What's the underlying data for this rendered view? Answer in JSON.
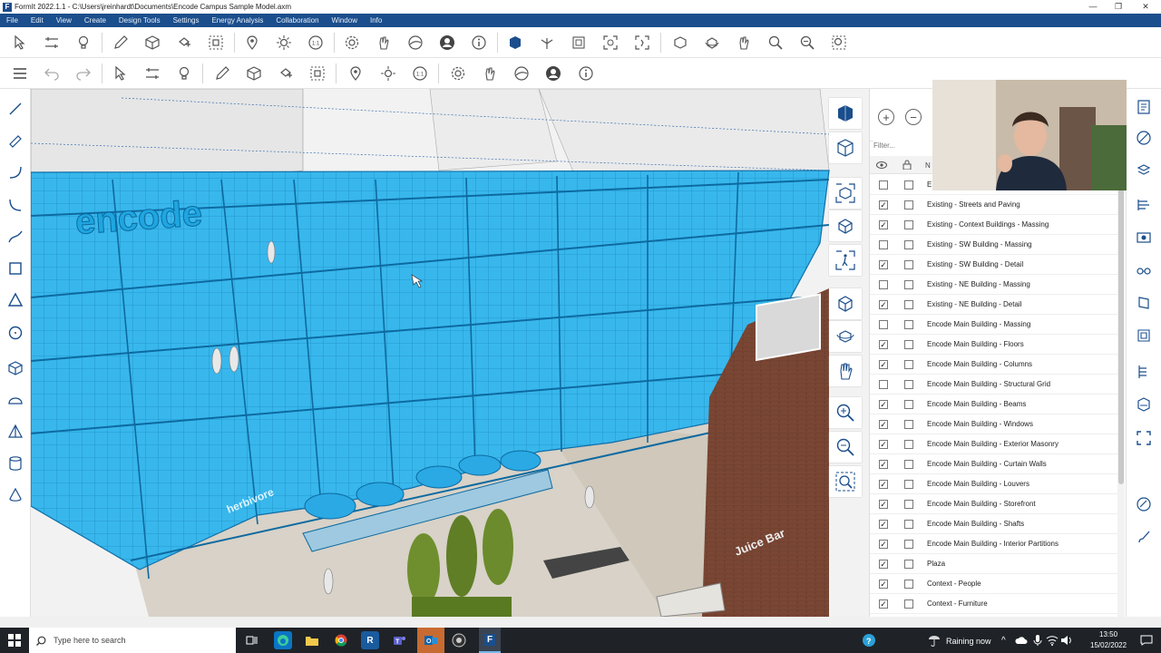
{
  "window": {
    "title": "FormIt 2022.1.1 - C:\\Users\\jreinhardt\\Documents\\Encode Campus Sample Model.axm",
    "logo": "F",
    "minimize": "—",
    "restore": "❐",
    "close": "✕"
  },
  "menu": [
    "File",
    "Edit",
    "View",
    "Create",
    "Design Tools",
    "Settings",
    "Energy Analysis",
    "Collaboration",
    "Window",
    "Info"
  ],
  "panel": {
    "add": "+",
    "remove": "−",
    "filter_placeholder": "Filter...",
    "header_name": "N",
    "layers": [
      {
        "name": "E",
        "visible": false,
        "locked": false
      },
      {
        "name": "Existing - Streets and Paving",
        "visible": true,
        "locked": false
      },
      {
        "name": "Existing - Context Buildings - Massing",
        "visible": true,
        "locked": false
      },
      {
        "name": "Existing - SW Building - Massing",
        "visible": false,
        "locked": false
      },
      {
        "name": "Existing - SW Building - Detail",
        "visible": true,
        "locked": false
      },
      {
        "name": "Existing - NE Building - Massing",
        "visible": false,
        "locked": false
      },
      {
        "name": "Existing - NE Building - Detail",
        "visible": true,
        "locked": false
      },
      {
        "name": "Encode Main Building - Massing",
        "visible": false,
        "locked": false
      },
      {
        "name": "Encode Main Building - Floors",
        "visible": true,
        "locked": false
      },
      {
        "name": "Encode Main Building - Columns",
        "visible": true,
        "locked": false
      },
      {
        "name": "Encode Main Building - Structural Grid",
        "visible": false,
        "locked": false
      },
      {
        "name": "Encode Main Building - Beams",
        "visible": true,
        "locked": false
      },
      {
        "name": "Encode Main Building - Windows",
        "visible": true,
        "locked": false
      },
      {
        "name": "Encode Main Building - Exterior Masonry",
        "visible": true,
        "locked": false
      },
      {
        "name": "Encode Main Building - Curtain Walls",
        "visible": true,
        "locked": false
      },
      {
        "name": "Encode Main Building - Louvers",
        "visible": true,
        "locked": false
      },
      {
        "name": "Encode Main Building - Storefront",
        "visible": true,
        "locked": false
      },
      {
        "name": "Encode Main Building - Shafts",
        "visible": true,
        "locked": false
      },
      {
        "name": "Encode Main Building - Interior Partitions",
        "visible": true,
        "locked": false
      },
      {
        "name": "Plaza",
        "visible": true,
        "locked": false
      },
      {
        "name": "Context - People",
        "visible": true,
        "locked": false
      },
      {
        "name": "Context - Furniture",
        "visible": true,
        "locked": false
      }
    ]
  },
  "scene": {
    "sign_encode": "encode",
    "sign_herbivore": "herbivore",
    "sign_juicebar": "Juice Bar"
  },
  "taskbar": {
    "search_placeholder": "Type here to search",
    "weather": "Raining now",
    "time": "13:50",
    "date": "15/02/2022",
    "accent": "#1f2328"
  },
  "colors": {
    "menubar": "#1a4e8c",
    "selection": "#35b6ec"
  }
}
